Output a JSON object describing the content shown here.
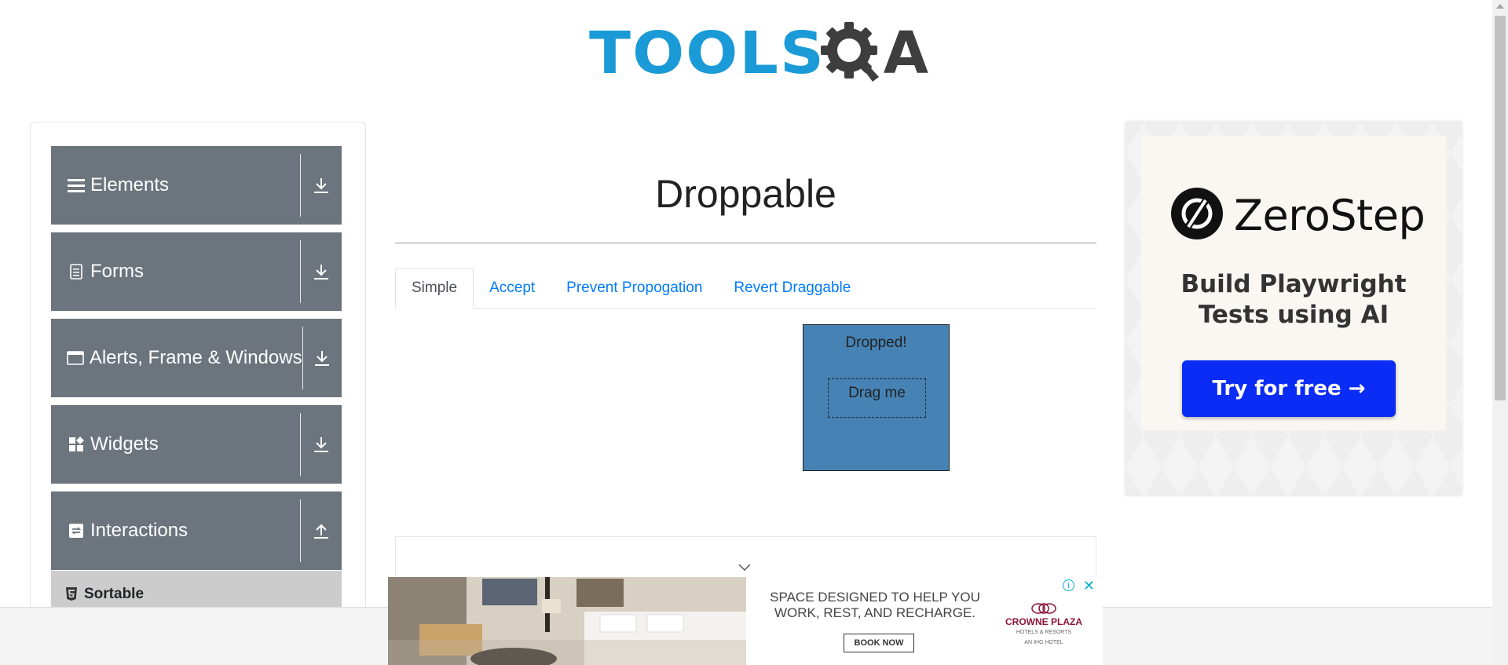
{
  "logo": {
    "part1": "TOOLS",
    "part2": "A"
  },
  "sidebar": {
    "groups": [
      {
        "label": "Elements",
        "icon": "hamburger-icon",
        "arrow": "download-arrow-icon"
      },
      {
        "label": "Forms",
        "icon": "document-icon",
        "arrow": "download-arrow-icon"
      },
      {
        "label": "Alerts, Frame & Windows",
        "icon": "window-icon",
        "arrow": "download-arrow-icon"
      },
      {
        "label": "Widgets",
        "icon": "widgets-icon",
        "arrow": "download-arrow-icon"
      },
      {
        "label": "Interactions",
        "icon": "interactions-icon",
        "arrow": "upload-arrow-icon"
      }
    ],
    "active_sub_item": "Sortable"
  },
  "main": {
    "title": "Droppable",
    "tabs": [
      {
        "label": "Simple",
        "active": true
      },
      {
        "label": "Accept",
        "active": false
      },
      {
        "label": "Prevent Propogation",
        "active": false
      },
      {
        "label": "Revert Draggable",
        "active": false
      }
    ],
    "drop_text": "Dropped!",
    "drag_text": "Drag me"
  },
  "right_ad": {
    "brand": "ZeroStep",
    "headline_line1": "Build Playwright",
    "headline_line2": "Tests using AI",
    "cta": "Try for free →"
  },
  "bottom_ad": {
    "line1": "SPACE DESIGNED TO HELP YOU",
    "line2": "WORK, REST, AND RECHARGE.",
    "cta": "BOOK NOW",
    "brand_line1": "CROWNE PLAZA",
    "brand_line2": "HOTELS & RESORTS",
    "brand_line3": "AN IHG HOTEL",
    "info": "i",
    "close": "✕"
  },
  "colors": {
    "brand_blue": "#1a9ad6",
    "sidebar_gray": "#6c757d",
    "drop_box": "#4682b4",
    "link": "#007bff",
    "cta_blue": "#0a2cf5"
  }
}
